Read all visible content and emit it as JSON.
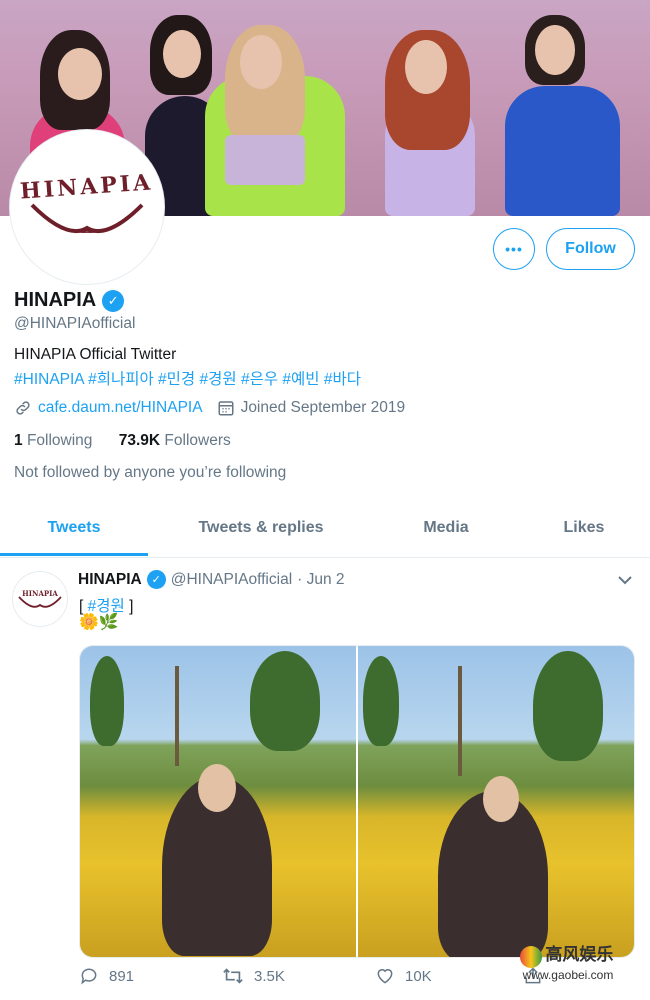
{
  "profile": {
    "display_name": "HINAPIA",
    "handle": "@HINAPIAofficial",
    "avatar_logo_text": "HINAPIA",
    "bio": "HINAPIA Official Twitter",
    "hashtags": "#HINAPIA #희나피아 #민경 #경원 #은우 #예빈 #바다",
    "link": "cafe.daum.net/HINAPIA",
    "joined": "Joined September 2019",
    "following_count": "1",
    "following_label": "Following",
    "followers_count": "73.9K",
    "followers_label": "Followers",
    "not_followed_text": "Not followed by anyone you’re following"
  },
  "buttons": {
    "more_label": "•••",
    "follow_label": "Follow"
  },
  "tabs": [
    {
      "label": "Tweets",
      "active": true
    },
    {
      "label": "Tweets & replies",
      "active": false
    },
    {
      "label": "Media",
      "active": false
    },
    {
      "label": "Likes",
      "active": false
    }
  ],
  "tweet": {
    "author_name": "HINAPIA",
    "author_handle": "@HINAPIAofficial",
    "date": "· Jun 2",
    "text_prefix": "[ ",
    "hashtag": "#경원",
    "text_suffix": " ]",
    "emoji": "🌼🌿",
    "replies": "891",
    "retweets": "3.5K",
    "likes": "10K"
  },
  "watermark": {
    "text": "高风娱乐",
    "url": "www.gaobei.com"
  },
  "colors": {
    "accent": "#1da1f2",
    "secondary_text": "#657786",
    "logo_red": "#6e1f2a"
  }
}
